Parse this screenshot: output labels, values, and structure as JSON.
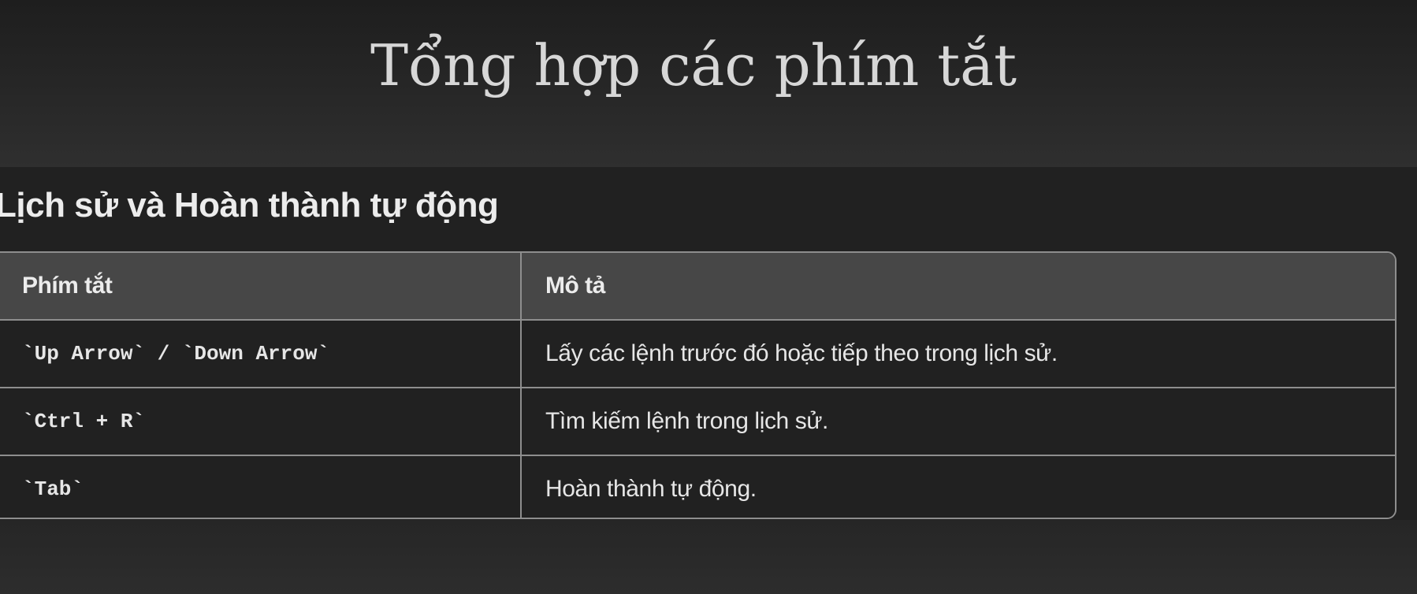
{
  "slide": {
    "title": "Tổng hợp các phím tắt"
  },
  "section": {
    "heading": "Lịch sử và Hoàn thành tự động"
  },
  "table": {
    "headers": [
      "Phím tắt",
      "Mô tả"
    ],
    "rows": [
      {
        "shortcut": "`Up Arrow` / `Down Arrow`",
        "description": "Lấy các lệnh trước đó hoặc tiếp theo trong lịch sử."
      },
      {
        "shortcut": "`Ctrl + R`",
        "description": "Tìm kiếm lệnh trong lịch sử."
      },
      {
        "shortcut": "`Tab`",
        "description": "Hoàn thành tự động."
      }
    ]
  },
  "colors": {
    "background": "#232323",
    "header_row": "#474747",
    "border": "#8e8e8e",
    "text": "#ececec"
  }
}
